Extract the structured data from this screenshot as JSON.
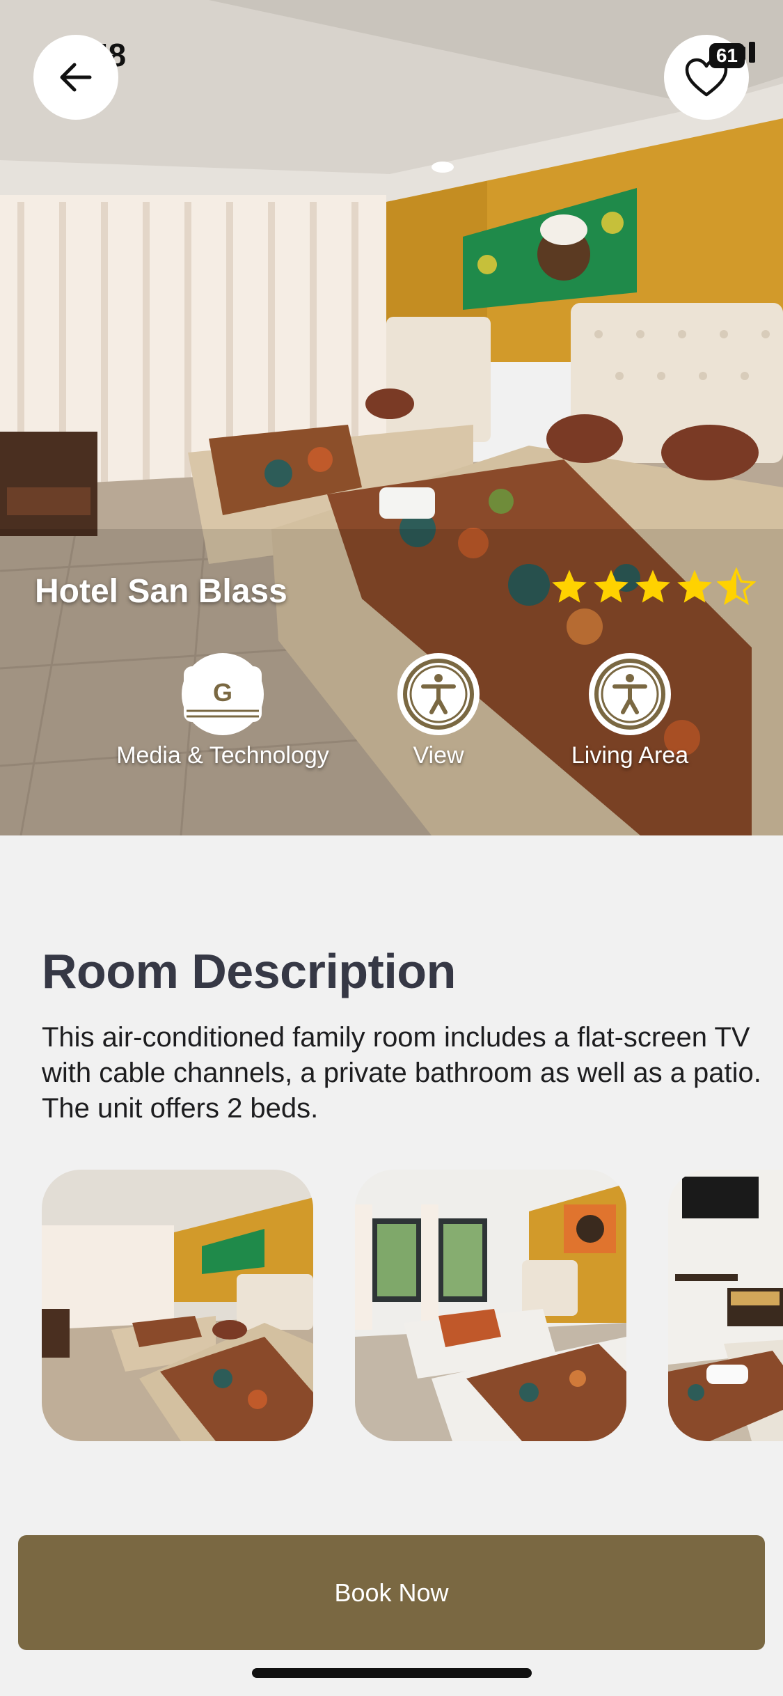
{
  "status_bar": {
    "time": "15.48",
    "battery": "61"
  },
  "header": {
    "back_icon": "arrow-left-icon",
    "favorite_icon": "heart-icon"
  },
  "hotel": {
    "name": "Hotel San Blass",
    "rating": 4.5,
    "rating_max": 5,
    "star_color": "#ffd200"
  },
  "features": [
    {
      "label": "Media & Technology",
      "icon": "google-g-icon"
    },
    {
      "label": "View",
      "icon": "accessibility-icon"
    },
    {
      "label": "Living Area",
      "icon": "accessibility-icon"
    }
  ],
  "room": {
    "title": "Room Description",
    "description": "This air-conditioned family room includes a flat-screen TV with cable channels, a private bathroom as well as a patio. The unit offers 2 beds."
  },
  "gallery": [
    {
      "name": "room-photo-1"
    },
    {
      "name": "room-photo-2"
    },
    {
      "name": "room-photo-3"
    }
  ],
  "cta": {
    "label": "Book Now",
    "color": "#7a6842"
  }
}
